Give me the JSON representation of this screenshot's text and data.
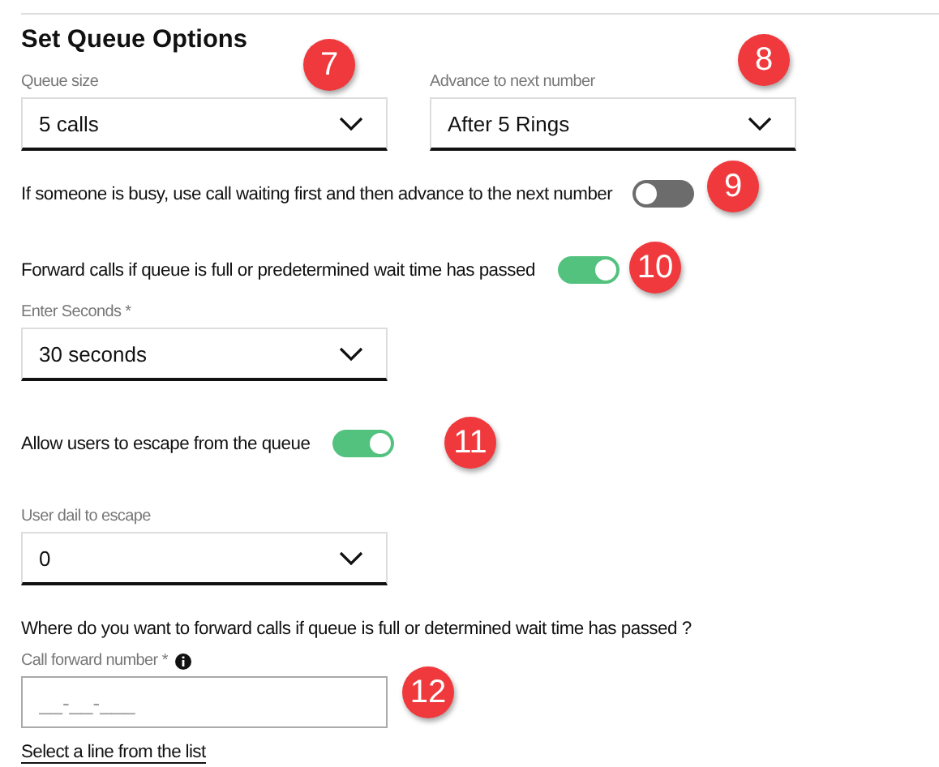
{
  "title": "Set Queue Options",
  "queue_size": {
    "label": "Queue size",
    "value": "5 calls"
  },
  "advance": {
    "label": "Advance to next number",
    "value": "After 5 Rings"
  },
  "call_waiting": {
    "label": "If someone is busy, use call waiting first and then advance to the next number",
    "on": false
  },
  "forward_calls": {
    "label": "Forward calls if queue is full or predetermined wait time has passed",
    "on": true
  },
  "seconds": {
    "label": "Enter Seconds *",
    "value": "30 seconds"
  },
  "escape": {
    "label": "Allow users to escape from the queue",
    "on": true
  },
  "escape_digit": {
    "label": "User dail to escape",
    "value": "0"
  },
  "question": "Where do you want to forward calls if queue is full or determined wait time has passed ?",
  "forward_number": {
    "label": "Call forward number *",
    "placeholder": "__-__-___"
  },
  "select_link": "Select a line from the list",
  "callouts": [
    {
      "number": "7"
    },
    {
      "number": "8"
    },
    {
      "number": "9"
    },
    {
      "number": "10"
    },
    {
      "number": "11"
    },
    {
      "number": "12"
    }
  ]
}
